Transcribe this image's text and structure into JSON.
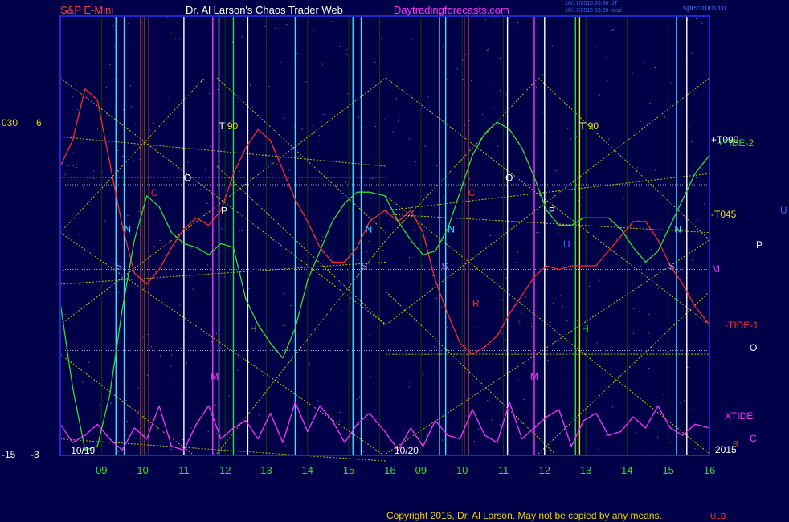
{
  "header": {
    "instrument": "S&P E-Mini",
    "site": "Dr. Al Larson's Chaos Trader Web",
    "url": "Daytradingforecasts.com",
    "timestamp_1": "10/17/2015 20:30 UT",
    "timestamp_2": "10/17/2015 15:30 local",
    "filename": "spectrum.txt"
  },
  "footer": {
    "copyright": "Copyright 2015, Dr. Al Larson. May not be copied by any means.",
    "tail_mark": "ULB"
  },
  "left_axis": {
    "top_left": "030",
    "top_right": "6",
    "bottom_left": "-15",
    "bottom_right": "-3"
  },
  "right_labels": {
    "t090": "+T090",
    "tide2": "+TIDE-2",
    "t045": "-T045",
    "u": "U",
    "p": "P",
    "m": "M",
    "tide1": "-TIDE-1",
    "o": "O",
    "xtide": "XTIDE",
    "c": "C",
    "year": "2015",
    "r": "R"
  },
  "colors": {
    "background": "#000048",
    "frame": "#1a2ad0",
    "hour_grid": "#0c3f0c",
    "yellow_lines": "#e6e600",
    "red_tide": "#ff2a2a",
    "green_tide": "#33dd33",
    "magenta_xtide": "#ff33ff",
    "header_red": "#ff4040",
    "header_white": "#ffffff",
    "header_magenta": "#ff33ff",
    "hour_label": "#33dd33",
    "copyright": "#f0d000"
  },
  "chart_data": {
    "type": "line",
    "title": "S&P E-Mini",
    "x_unit": "hour",
    "sessions": [
      {
        "date": "10/19",
        "hour_ticks": [
          "09",
          "10",
          "11",
          "12",
          "13",
          "14",
          "15",
          "16"
        ]
      },
      {
        "date": "10/20",
        "hour_ticks": [
          "09",
          "10",
          "11",
          "12",
          "13",
          "14",
          "15",
          "16"
        ]
      }
    ],
    "x_range": [
      0,
      15.75
    ],
    "y_range": [
      -3,
      6
    ],
    "y_tick_labels": {
      "top": "6",
      "bottom": "-3"
    },
    "series": [
      {
        "name": "TIDE-1",
        "color": "#ff2a2a",
        "x": [
          0,
          0.3,
          0.6,
          0.9,
          1.2,
          1.5,
          1.8,
          2.1,
          2.4,
          2.7,
          3.0,
          3.3,
          3.6,
          3.9,
          4.2,
          4.5,
          4.8,
          5.1,
          5.4,
          5.7,
          6.0,
          6.3,
          6.6,
          6.9,
          7.2,
          7.5,
          7.875,
          8.2,
          8.5,
          8.8,
          9.1,
          9.4,
          9.7,
          10.0,
          10.3,
          10.6,
          10.9,
          11.2,
          11.5,
          11.8,
          12.1,
          12.4,
          12.7,
          13.0,
          13.3,
          13.6,
          13.9,
          14.2,
          14.5,
          14.8,
          15.1,
          15.4,
          15.75
        ],
        "y": [
          4.8,
          5.5,
          6.9,
          6.6,
          4.9,
          3.2,
          1.9,
          1.6,
          2.0,
          2.6,
          3.1,
          3.4,
          3.2,
          3.6,
          4.6,
          5.3,
          5.8,
          5.5,
          4.7,
          3.9,
          3.3,
          2.6,
          2.2,
          2.2,
          2.6,
          3.3,
          3.6,
          3.3,
          3.6,
          3.0,
          1.7,
          0.8,
          0.0,
          -0.3,
          -0.1,
          0.2,
          0.8,
          1.3,
          1.8,
          2.1,
          2.0,
          2.1,
          2.1,
          2.1,
          2.5,
          2.9,
          3.3,
          3.3,
          2.8,
          2.1,
          1.6,
          1.0,
          0.5
        ]
      },
      {
        "name": "TIDE-2",
        "color": "#33dd33",
        "x": [
          0,
          0.3,
          0.6,
          0.9,
          1.2,
          1.5,
          1.8,
          2.1,
          2.4,
          2.7,
          3.0,
          3.3,
          3.6,
          3.9,
          4.2,
          4.5,
          4.8,
          5.1,
          5.4,
          5.7,
          6.0,
          6.3,
          6.6,
          6.9,
          7.2,
          7.5,
          7.875,
          8.2,
          8.5,
          8.8,
          9.1,
          9.4,
          9.7,
          10.0,
          10.3,
          10.6,
          10.9,
          11.2,
          11.5,
          11.8,
          12.1,
          12.4,
          12.7,
          13.0,
          13.3,
          13.6,
          13.9,
          14.2,
          14.5,
          14.8,
          15.1,
          15.4,
          15.75
        ],
        "y": [
          1.1,
          -1.2,
          -2.9,
          -2.8,
          -1.4,
          0.9,
          2.8,
          4.0,
          3.7,
          3.0,
          2.7,
          2.6,
          2.4,
          2.7,
          2.6,
          1.2,
          0.5,
          0.0,
          -0.4,
          0.4,
          1.7,
          2.5,
          3.3,
          3.8,
          4.1,
          4.1,
          4.0,
          3.3,
          2.8,
          2.4,
          2.5,
          3.1,
          4.1,
          5.1,
          5.7,
          6.0,
          5.8,
          5.3,
          4.5,
          3.6,
          3.2,
          3.2,
          3.4,
          3.4,
          3.4,
          3.1,
          2.6,
          2.2,
          2.5,
          3.2,
          3.9,
          4.6,
          5.1
        ]
      },
      {
        "name": "XTIDE",
        "color": "#ff33ff",
        "x": [
          0,
          0.3,
          0.6,
          0.9,
          1.2,
          1.5,
          1.8,
          2.1,
          2.4,
          2.7,
          3.0,
          3.3,
          3.6,
          3.9,
          4.2,
          4.5,
          4.8,
          5.1,
          5.4,
          5.7,
          6.0,
          6.3,
          6.6,
          6.9,
          7.2,
          7.5,
          7.875,
          8.2,
          8.5,
          8.8,
          9.1,
          9.4,
          9.7,
          10.0,
          10.3,
          10.6,
          10.9,
          11.2,
          11.5,
          11.8,
          12.1,
          12.4,
          12.7,
          13.0,
          13.3,
          13.6,
          13.9,
          14.2,
          14.5,
          14.8,
          15.1,
          15.4,
          15.75
        ],
        "y": [
          -2.2,
          -2.7,
          -2.5,
          -2.2,
          -2.6,
          -2.9,
          -2.3,
          -2.6,
          -1.7,
          -2.8,
          -2.9,
          -2.2,
          -1.7,
          -2.6,
          -2.3,
          -2.1,
          -2.6,
          -1.9,
          -2.7,
          -1.6,
          -2.4,
          -1.7,
          -2.1,
          -2.7,
          -2.2,
          -1.9,
          -2.4,
          -2.9,
          -2.3,
          -2.8,
          -2.1,
          -2.5,
          -2.6,
          -1.8,
          -2.5,
          -2.7,
          -1.6,
          -2.6,
          -2.3,
          -2.0,
          -1.8,
          -2.8,
          -2.1,
          -1.9,
          -2.5,
          -2.4,
          -2.0,
          -2.3,
          -1.7,
          -2.3,
          -2.5,
          -2.2,
          -2.3
        ]
      }
    ],
    "vertical_markers": [
      {
        "x": 1.35,
        "color": "#40e0ff"
      },
      {
        "x": 1.55,
        "color": "#40e0ff"
      },
      {
        "x": 1.95,
        "color": "#ff2a2a"
      },
      {
        "x": 2.05,
        "color": "#d07000"
      },
      {
        "x": 2.15,
        "color": "#ff2a2a"
      },
      {
        "x": 3.0,
        "color": "#ffffff"
      },
      {
        "x": 3.7,
        "color": "#ff33ff"
      },
      {
        "x": 3.85,
        "color": "#ffffff"
      },
      {
        "x": 4.2,
        "color": "#33dd33"
      },
      {
        "x": 4.55,
        "color": "#ffffff"
      },
      {
        "x": 5.7,
        "color": "#40e0ff"
      },
      {
        "x": 7.1,
        "color": "#40e0ff"
      },
      {
        "x": 7.3,
        "color": "#40e0ff"
      },
      {
        "x": 9.2,
        "color": "#40e0ff"
      },
      {
        "x": 9.35,
        "color": "#40e0ff"
      },
      {
        "x": 9.8,
        "color": "#ff2a2a"
      },
      {
        "x": 9.9,
        "color": "#d07000"
      },
      {
        "x": 10.85,
        "color": "#ffffff"
      },
      {
        "x": 11.5,
        "color": "#ff33ff"
      },
      {
        "x": 11.75,
        "color": "#ffffff"
      },
      {
        "x": 12.5,
        "color": "#33dd33"
      },
      {
        "x": 12.6,
        "color": "#e6e600"
      },
      {
        "x": 14.95,
        "color": "#40e0ff"
      },
      {
        "x": 15.2,
        "color": "#ffffff"
      }
    ],
    "event_labels": [
      {
        "text": "T",
        "x": 3.85,
        "y": 5.8,
        "color": "#ffffff"
      },
      {
        "text": "90",
        "x": 4.05,
        "y": 5.8,
        "color": "#e6e600"
      },
      {
        "text": "O",
        "x": 3.0,
        "y": 4.4,
        "color": "#ffffff"
      },
      {
        "text": "C",
        "x": 2.2,
        "y": 4.0,
        "color": "#ff2a2a"
      },
      {
        "text": "P",
        "x": 3.9,
        "y": 3.5,
        "color": "#ffffff"
      },
      {
        "text": "N",
        "x": 1.55,
        "y": 3.0,
        "color": "#40e0ff"
      },
      {
        "text": "S",
        "x": 1.35,
        "y": 2.0,
        "color": "#c080ff"
      },
      {
        "text": "H",
        "x": 4.6,
        "y": 0.3,
        "color": "#33dd33"
      },
      {
        "text": "M",
        "x": 3.65,
        "y": -1.0,
        "color": "#ff33ff"
      },
      {
        "text": "N",
        "x": 7.4,
        "y": 3.0,
        "color": "#40e0ff"
      },
      {
        "text": "S",
        "x": 7.3,
        "y": 2.0,
        "color": "#c080ff"
      },
      {
        "text": "T",
        "x": 12.6,
        "y": 5.8,
        "color": "#ffffff"
      },
      {
        "text": "90",
        "x": 12.8,
        "y": 5.8,
        "color": "#e6e600"
      },
      {
        "text": "O",
        "x": 10.8,
        "y": 4.4,
        "color": "#ffffff"
      },
      {
        "text": "C",
        "x": 9.9,
        "y": 4.0,
        "color": "#ff2a2a"
      },
      {
        "text": "P",
        "x": 11.85,
        "y": 3.5,
        "color": "#ffffff"
      },
      {
        "text": "N",
        "x": 9.4,
        "y": 3.0,
        "color": "#40e0ff"
      },
      {
        "text": "S",
        "x": 9.25,
        "y": 2.0,
        "color": "#c080ff"
      },
      {
        "text": "U",
        "x": 12.2,
        "y": 2.6,
        "color": "#3b6bff"
      },
      {
        "text": "R",
        "x": 10.0,
        "y": 1.0,
        "color": "#ff2a2a"
      },
      {
        "text": "H",
        "x": 12.65,
        "y": 0.3,
        "color": "#33dd33"
      },
      {
        "text": "M",
        "x": 11.4,
        "y": -1.0,
        "color": "#ff33ff"
      },
      {
        "text": "N",
        "x": 14.9,
        "y": 3.0,
        "color": "#40e0ff"
      },
      {
        "text": "S",
        "x": 14.75,
        "y": 2.0,
        "color": "#c080ff"
      }
    ]
  }
}
